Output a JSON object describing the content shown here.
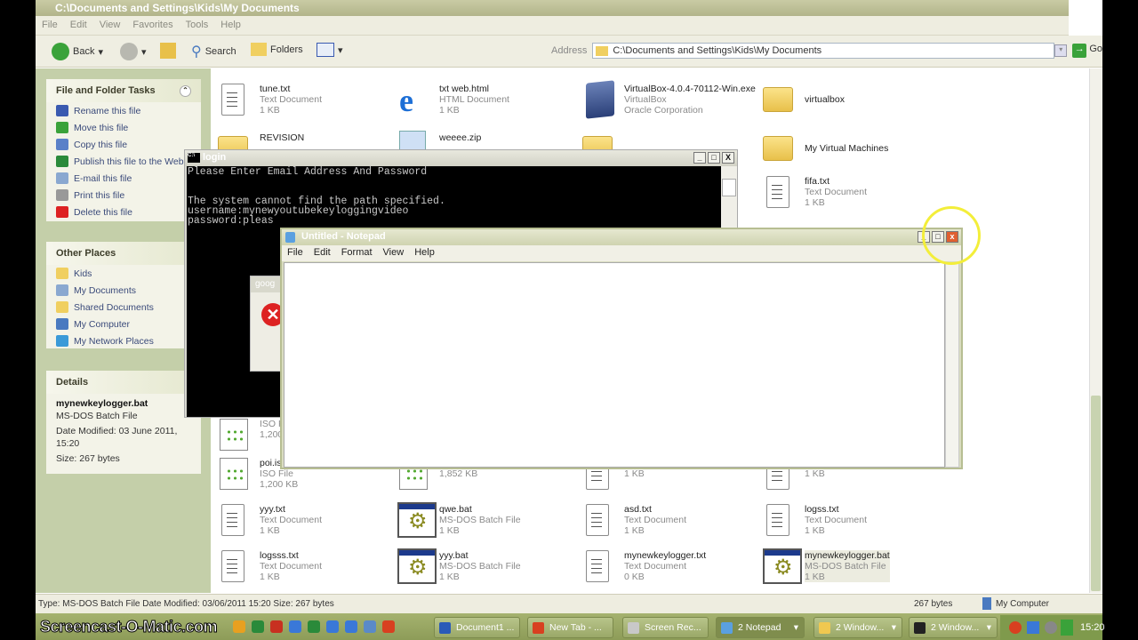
{
  "explorer": {
    "title": "C:\\Documents and Settings\\Kids\\My Documents",
    "menu": [
      "File",
      "Edit",
      "View",
      "Favorites",
      "Tools",
      "Help"
    ],
    "toolbar": {
      "back": "Back",
      "search": "Search",
      "folders": "Folders"
    },
    "address": {
      "label": "Address",
      "value": "C:\\Documents and Settings\\Kids\\My Documents",
      "go": "Go"
    },
    "tasks": {
      "title": "File and Folder Tasks",
      "items": [
        "Rename this file",
        "Move this file",
        "Copy this file",
        "Publish this file to the Web",
        "E-mail this file",
        "Print this file",
        "Delete this file"
      ]
    },
    "places": {
      "title": "Other Places",
      "items": [
        "Kids",
        "My Documents",
        "Shared Documents",
        "My Computer",
        "My Network Places"
      ]
    },
    "details": {
      "title": "Details",
      "name": "mynewkeylogger.bat",
      "type": "MS-DOS Batch File",
      "modified": "Date Modified: 03 June 2011, 15:20",
      "size": "Size: 267 bytes"
    },
    "files": [
      {
        "col": 0,
        "row": 0,
        "icon": "text",
        "name": "tune.txt",
        "type": "Text Document",
        "size": "1 KB"
      },
      {
        "col": 1,
        "row": 0,
        "icon": "html",
        "name": "txt web.html",
        "type": "HTML Document",
        "size": "1 KB"
      },
      {
        "col": 2,
        "row": 0,
        "icon": "exe",
        "name": "VirtualBox-4.0.4-70112-Win.exe",
        "type": "VirtualBox",
        "size": "Oracle Corporation"
      },
      {
        "col": 3,
        "row": 0,
        "icon": "folder",
        "name": "virtualbox",
        "type": "",
        "size": "",
        "mid": true
      },
      {
        "col": 0,
        "row": 1,
        "icon": "folder",
        "name": "REVISION",
        "type": "",
        "size": ""
      },
      {
        "col": 1,
        "row": 1,
        "icon": "zip",
        "name": "weeee.zip",
        "type": "",
        "size": ""
      },
      {
        "col": 2,
        "row": 1,
        "icon": "folder",
        "name": "",
        "type": "",
        "size": ""
      },
      {
        "col": 3,
        "row": 1,
        "icon": "folder",
        "name": "My Virtual Machines",
        "type": "",
        "size": "",
        "mid": true
      },
      {
        "col": 3,
        "row": 2,
        "icon": "text",
        "name": "fifa.txt",
        "type": "Text Document",
        "size": "1 KB"
      },
      {
        "col": 0,
        "row": 7,
        "icon": "iso",
        "name": "",
        "type": "ISO F",
        "size": "1,200"
      },
      {
        "col": 0,
        "row": 8,
        "icon": "iso",
        "name": "poi.is",
        "type": "ISO File",
        "size": "1,200 KB"
      },
      {
        "col": 1,
        "row": 8,
        "icon": "iso",
        "name": "",
        "type": "ISO File",
        "size": "1,852 KB"
      },
      {
        "col": 2,
        "row": 8,
        "icon": "text",
        "name": "",
        "type": "Text Document",
        "size": "1 KB"
      },
      {
        "col": 3,
        "row": 8,
        "icon": "text",
        "name": "",
        "type": "Text Document",
        "size": "1 KB"
      },
      {
        "col": 0,
        "row": 9,
        "icon": "text",
        "name": "yyy.txt",
        "type": "Text Document",
        "size": "1 KB"
      },
      {
        "col": 1,
        "row": 9,
        "icon": "bat",
        "name": "qwe.bat",
        "type": "MS-DOS Batch File",
        "size": "1 KB"
      },
      {
        "col": 2,
        "row": 9,
        "icon": "text",
        "name": "asd.txt",
        "type": "Text Document",
        "size": "1 KB"
      },
      {
        "col": 3,
        "row": 9,
        "icon": "text",
        "name": "logss.txt",
        "type": "Text Document",
        "size": "1 KB"
      },
      {
        "col": 0,
        "row": 10,
        "icon": "text",
        "name": "logsss.txt",
        "type": "Text Document",
        "size": "1 KB"
      },
      {
        "col": 1,
        "row": 10,
        "icon": "bat",
        "name": "yyy.bat",
        "type": "MS-DOS Batch File",
        "size": "1 KB"
      },
      {
        "col": 2,
        "row": 10,
        "icon": "text",
        "name": "mynewkeylogger.txt",
        "type": "Text Document",
        "size": "0 KB"
      },
      {
        "col": 3,
        "row": 10,
        "icon": "bat",
        "name": "mynewkeylogger.bat",
        "type": "MS-DOS Batch File",
        "size": "1 KB",
        "selected": true
      }
    ],
    "status": {
      "left": "Type: MS-DOS Batch File Date Modified: 03/06/2011 15:20 Size: 267 bytes",
      "size": "267 bytes",
      "zone": "My Computer"
    }
  },
  "console": {
    "title": "login",
    "lines": "Please Enter Email Address And Password\n\n\nThe system cannot find the path specified.\nusername:mynewyoutubekeyloggingvideo\npassword:pleas"
  },
  "error_dialog": {
    "title": "goog"
  },
  "notepad": {
    "title": "Untitled - Notepad",
    "menu": [
      "File",
      "Edit",
      "Format",
      "View",
      "Help"
    ],
    "content": ""
  },
  "taskbar": {
    "watermark": "Screencast-O-Matic.com",
    "quick_launch_colors": [
      "#e8a020",
      "#2a8a3a",
      "#c83020",
      "#3a78d8",
      "#2a8a3a",
      "#3a78d8",
      "#3a78d8",
      "#5a8ac8",
      "#d84020"
    ],
    "buttons": [
      {
        "label": "Document1 ...",
        "color": "#2a5ab8"
      },
      {
        "label": "New Tab - ...",
        "color": "#d84020"
      },
      {
        "label": "Screen Rec...",
        "color": "#c8c8c8"
      },
      {
        "label": "2 Notepad",
        "color": "#5aa0e0",
        "active": true
      },
      {
        "label": "2 Window...",
        "color": "#f0c850"
      },
      {
        "label": "2 Window...",
        "color": "#222"
      }
    ],
    "clock": "15:20"
  }
}
